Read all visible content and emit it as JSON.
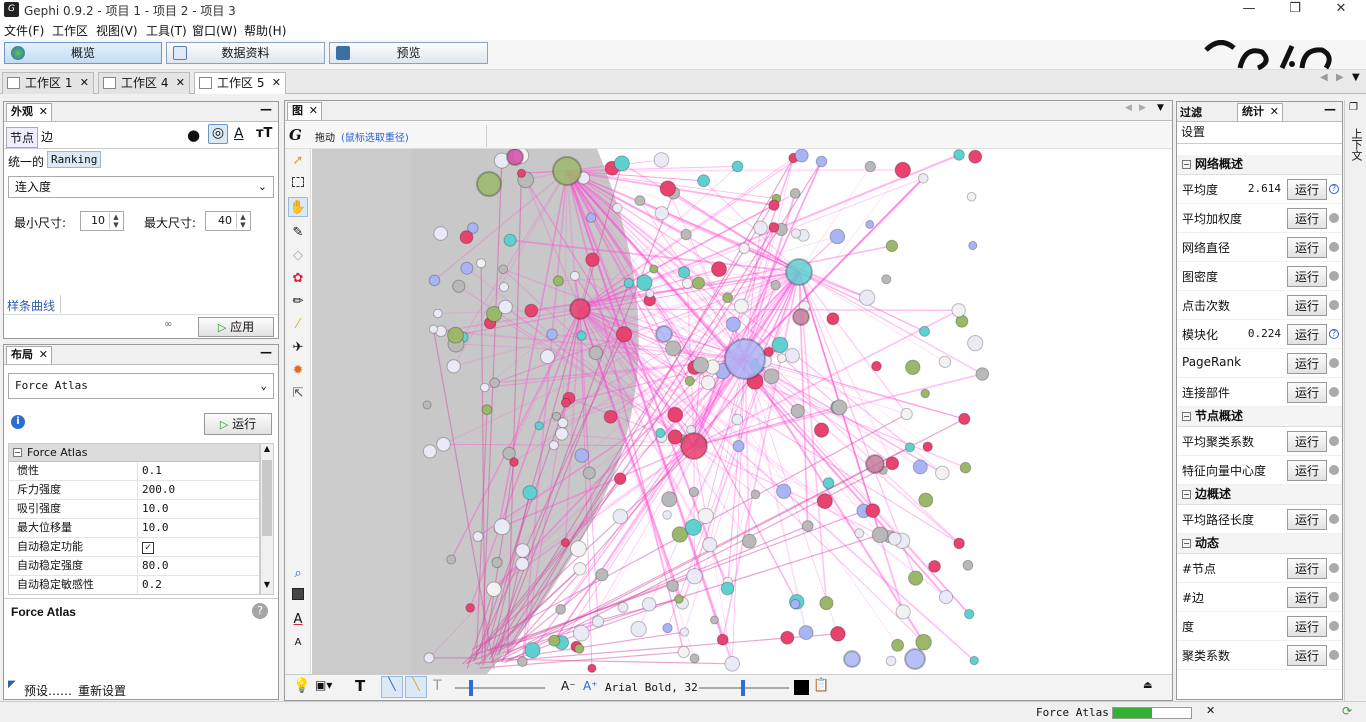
{
  "app": {
    "title": "Gephi 0.9.2 - 项目 1 - 项目 2 - 项目 3"
  },
  "menu": [
    "文件(F)",
    "工作区",
    "视图(V)",
    "工具(T)",
    "窗口(W)",
    "帮助(H)"
  ],
  "modes": [
    "概览",
    "数据资料",
    "预览"
  ],
  "workspaces": [
    "工作区 1",
    "工作区 4",
    "工作区 5"
  ],
  "appearance": {
    "tab": "外观",
    "sub_tabs": [
      "节点",
      "边"
    ],
    "mode_tabs": [
      "统一的",
      "Ranking"
    ],
    "attribute": "连入度",
    "min_size_label": "最小尺寸:",
    "min_size": "10",
    "max_size_label": "最大尺寸:",
    "max_size": "40",
    "spline_link": "样条曲线",
    "apply": "应用"
  },
  "layout": {
    "tab": "布局",
    "algorithm": "Force Atlas",
    "run": "运行",
    "section": "Force Atlas",
    "properties": [
      {
        "name": "惯性",
        "value": "0.1"
      },
      {
        "name": "斥力强度",
        "value": "200.0"
      },
      {
        "name": "吸引强度",
        "value": "10.0"
      },
      {
        "name": "最大位移量",
        "value": "10.0"
      },
      {
        "name": "自动稳定功能",
        "value": ""
      },
      {
        "name": "自动稳定强度",
        "value": "80.0"
      },
      {
        "name": "自动稳定敏感性",
        "value": "0.2"
      }
    ],
    "desc_title": "Force Atlas",
    "presets": "预设……",
    "reset": "重新设置"
  },
  "graph": {
    "tab": "图",
    "drag_label": "拖动",
    "drag_hint": "(鼠标选取重径)",
    "font_label": "Arial Bold, 32"
  },
  "filters_tab": "过滤",
  "stats": {
    "tab": "统计",
    "settings": "设置",
    "run_label": "运行",
    "groups": [
      {
        "title": "网络概述",
        "items": [
          {
            "name": "平均度",
            "value": "2.614",
            "info": true
          },
          {
            "name": "平均加权度",
            "value": "",
            "info": false
          },
          {
            "name": "网络直径",
            "value": "",
            "info": false
          },
          {
            "name": "图密度",
            "value": "",
            "info": false
          },
          {
            "name": "点击次数",
            "value": "",
            "info": false
          },
          {
            "name": "模块化",
            "value": "0.224",
            "info": true
          },
          {
            "name": "PageRank",
            "value": "",
            "info": false
          },
          {
            "name": "连接部件",
            "value": "",
            "info": false
          }
        ]
      },
      {
        "title": "节点概述",
        "items": [
          {
            "name": "平均聚类系数",
            "value": "",
            "info": false
          },
          {
            "name": "特征向量中心度",
            "value": "",
            "info": false
          }
        ]
      },
      {
        "title": "边概述",
        "items": [
          {
            "name": "平均路径长度",
            "value": "",
            "info": false
          }
        ]
      },
      {
        "title": "动态",
        "items": [
          {
            "name": "#节点",
            "value": "",
            "info": false
          },
          {
            "name": "#边",
            "value": "",
            "info": false
          },
          {
            "name": "度",
            "value": "",
            "info": false
          },
          {
            "name": "聚类系数",
            "value": "",
            "info": false
          }
        ]
      }
    ]
  },
  "side_strip": "上下文",
  "status": {
    "task": "Force Atlas",
    "progress": 0.5
  },
  "colors": {
    "accent": "#ff4fd8",
    "node_pink": "#e8426e",
    "node_blue": "#a9b4f5",
    "node_teal": "#5fd0d0",
    "node_green": "#9bb86a"
  }
}
